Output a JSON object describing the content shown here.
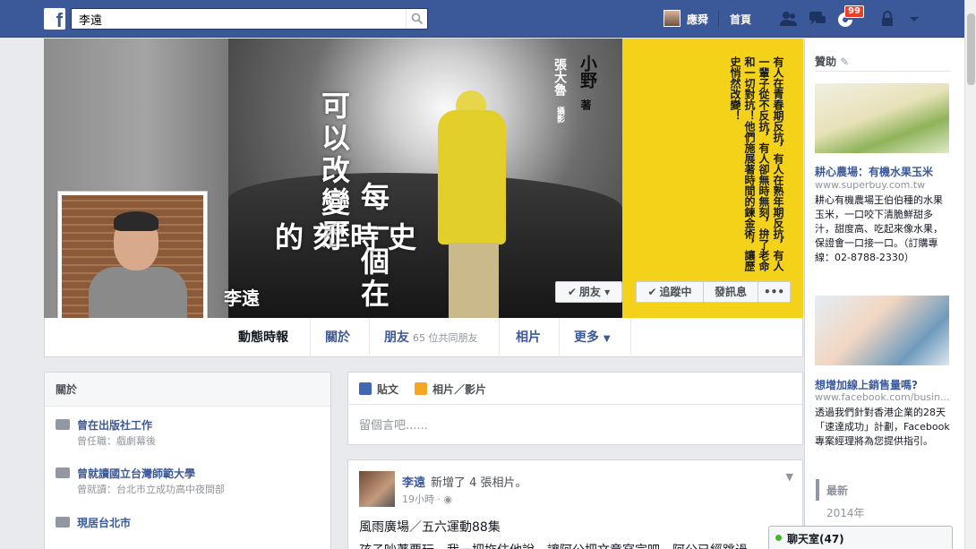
{
  "topbar": {
    "search_value": "李遠",
    "user_name": "應舜",
    "home_label": "首頁",
    "notification_count": "99"
  },
  "cover": {
    "title_line1": "可以改變歷",
    "title_line2": "每一個在",
    "title_line3": "的刻時史",
    "author": "小野",
    "author_suffix": "著",
    "photographer": "張大魯",
    "photo_suffix": "攝影",
    "poem": "有人在青春期反抗，有人在熟年期反抗，有人一輩子從不反抗，有人卻無時無刻，拚了老命和一切對抗！他們施展著時間的鍊金術，讓歷史悄然改變！",
    "profile_name": "李遠"
  },
  "buttons": {
    "friends": "朋友",
    "following": "追蹤中",
    "message": "發訊息",
    "more": "•••"
  },
  "nav": {
    "timeline": "動態時報",
    "about": "關於",
    "friends": "朋友",
    "friends_sub": "65 位共同朋友",
    "photos": "相片",
    "more": "更多"
  },
  "about": {
    "header": "關於",
    "items": [
      {
        "main": "曾在出版社工作",
        "sub": "曾任職：戲劇幕後"
      },
      {
        "main": "曾就讀國立台灣師範大學",
        "sub": "曾就讀：台北市立成功高中夜間部"
      },
      {
        "main": "現居台北市",
        "sub": ""
      }
    ]
  },
  "composer": {
    "tab_post": "貼文",
    "tab_photo": "相片／影片",
    "placeholder": "留個言吧......"
  },
  "post": {
    "author": "李遠",
    "action": "新增了 4 張相片。",
    "time": "19小時 · ",
    "text1": "風雨廣場／五六運動88集",
    "text2": "孩子吵著要玩，我一把拖住他說，讓阿公把文章寫完吧，阿公已經跳過"
  },
  "sidebar": {
    "sponsored": "贊助",
    "ads": [
      {
        "title": "耕心農場：有機水果玉米",
        "url": "www.superbuy.com.tw",
        "desc": "耕心有機農場王伯伯種的水果玉米，一口咬下清脆鮮甜多汁，甜度高、吃起來像水果，保證會一口接一口。（訂購專線：02-8788-2330）"
      },
      {
        "title": "想增加線上銷售量嗎?",
        "url": "www.facebook.com/busin...",
        "desc": "透過我們針對香港企業的28天「速達成功」計劃，Facebook專案經理將為您提供指引。"
      }
    ],
    "recent": "最新",
    "year": "2014年"
  },
  "chat": {
    "label": "聊天室(47)"
  }
}
